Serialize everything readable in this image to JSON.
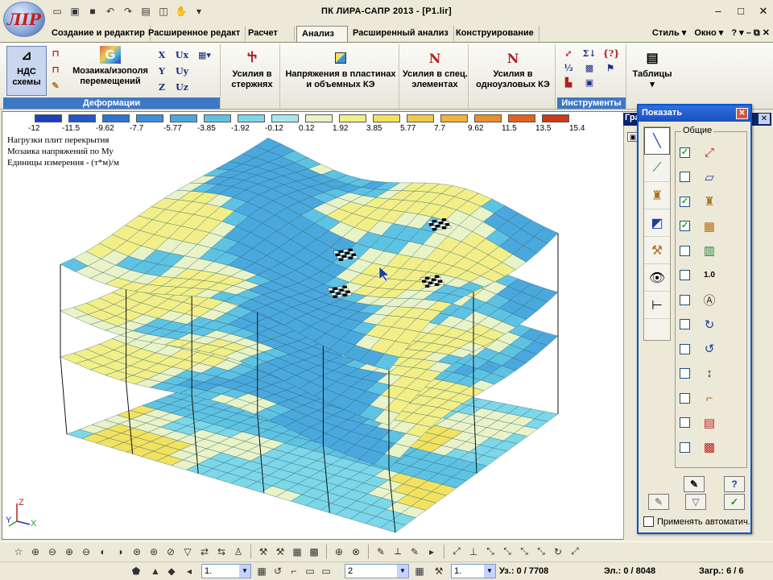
{
  "window": {
    "title": "ПК ЛИРА-САПР  2013 - [P1.lir]",
    "logo_text": "ЛІР"
  },
  "ribbon_tabs": [
    {
      "label": "Создание и редактир"
    },
    {
      "label": "Расширенное редакт"
    },
    {
      "label": "Расчет"
    },
    {
      "label": "Анализ"
    },
    {
      "label": "Расширенный анализ"
    },
    {
      "label": "Конструирование"
    }
  ],
  "ribbon_right": {
    "style": "Стиль",
    "window": "Окно",
    "help": "?"
  },
  "ribbon": {
    "ndc_label": "НДС\nсхемы",
    "mosaic_label": "Мозаика/изополя\nперемещений",
    "deform_caption": "Деформации",
    "axes": [
      "X",
      "Y",
      "Z"
    ],
    "uaxes": [
      "Ux",
      "Uy",
      "Uz"
    ],
    "rod_forces": "Усилия в\nстержнях",
    "plate_stress": "Напряжения в пластинах\nи объемных КЭ",
    "special_forces": "Усилия в спец.\nэлементах",
    "single_node_forces": "Усилия в\nодноузловых КЭ",
    "tools_caption": "Инструменты",
    "tables": "Таблицы"
  },
  "scale": {
    "labels": [
      "-12",
      "-11.5",
      "-9.62",
      "-7.7",
      "-5.77",
      "-3.85",
      "-1.92",
      "-0.12",
      "0.12",
      "1.92",
      "3.85",
      "5.77",
      "7.7",
      "9.62",
      "11.5",
      "13.5",
      "15.4"
    ],
    "colors": [
      "#1a3fbf",
      "#1f59c9",
      "#2f74d2",
      "#3c90d9",
      "#4aa8dd",
      "#5ec3e3",
      "#7cd7e8",
      "#a8e8ee",
      "#e9f3c8",
      "#f2ef88",
      "#f2e25f",
      "#f0c94a",
      "#efb23a",
      "#ea8f2a",
      "#e2621f",
      "#cc3a1a"
    ]
  },
  "info_lines": [
    "Нагрузки плит перекрытия",
    "Мозаика напряжений по Му",
    "Единицы измерения - (т*м)/м"
  ],
  "side_panel": {
    "title": "Гра"
  },
  "dialog": {
    "title": "Показать",
    "group_caption": "Общие",
    "auto_apply": "Применять автоматич.",
    "rows_checked": [
      true,
      false,
      true,
      true,
      false,
      false,
      false,
      false,
      false,
      false,
      false,
      false,
      false
    ],
    "row_icons": [
      "axes-icon",
      "box-icon",
      "support-icon",
      "grid-icon",
      "frame-grid-icon",
      "dimension-icon",
      "node-label-icon",
      "rotate-icon",
      "rotate-z-icon",
      "spacing-icon",
      "rigid-insert-icon",
      "element-icon",
      "solid-element-icon"
    ],
    "row_glyphs": [
      "⤢",
      "▱",
      "♜",
      "▦",
      "▥",
      "1.0",
      "Ⓐ",
      "↻",
      "↺",
      "↕",
      "⌐",
      "▤",
      "▩"
    ],
    "btn_help": "?"
  },
  "status": {
    "combo1": "1.",
    "combo2": "2",
    "combo3": "1.",
    "nodes": "Уз.: 0 / 7708",
    "elements": "Эл.: 0 / 8048",
    "loads": "Загр.: 6 / 6"
  },
  "axes_indicator": {
    "z": "Z",
    "y": "Y",
    "x": "X"
  }
}
